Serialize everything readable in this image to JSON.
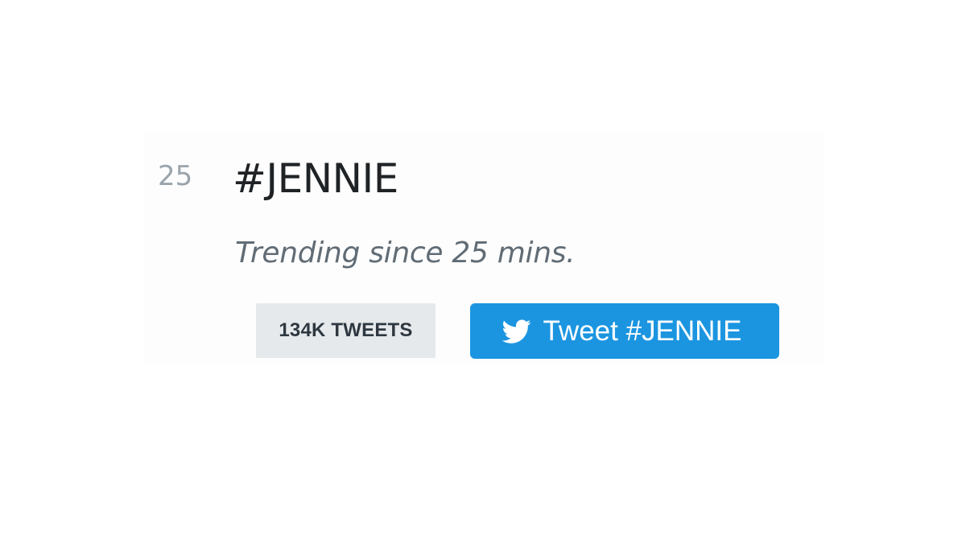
{
  "trend": {
    "rank": "25",
    "hashtag": "#JENNIE",
    "trending_since": "Trending since 25 mins.",
    "tweet_count": "134K TWEETS",
    "tweet_button_label": "Tweet #JENNIE"
  },
  "colors": {
    "button_bg": "#1b95e0",
    "badge_bg": "#e5e9ec"
  },
  "icons": {
    "tweet_button_icon": "twitter-bird-icon"
  }
}
